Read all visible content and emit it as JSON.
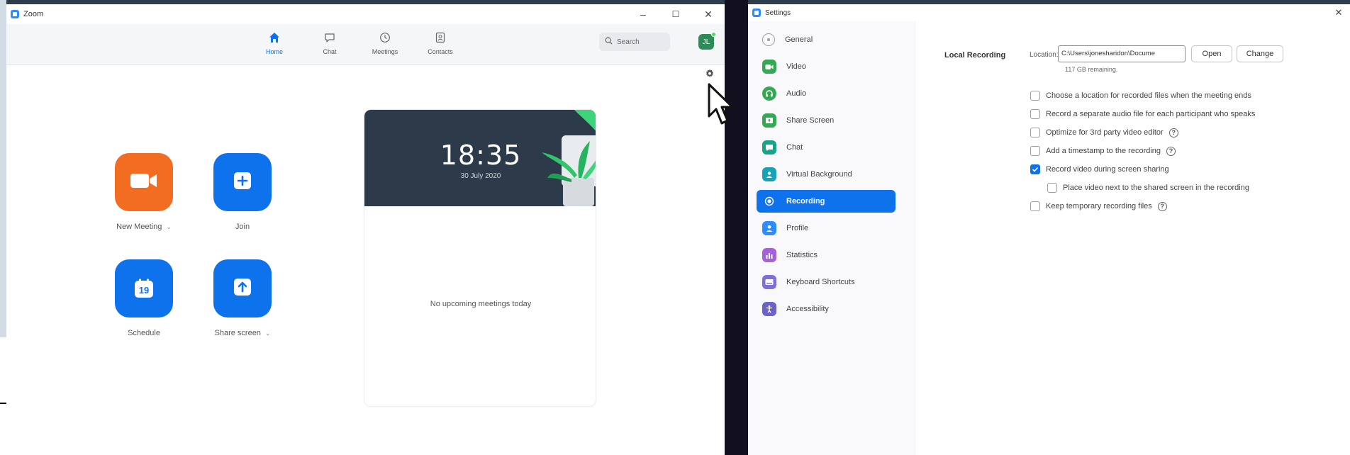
{
  "zoom": {
    "title": "Zoom",
    "window_controls": {
      "minimize": "–",
      "maximize": "☐",
      "close": "✕"
    },
    "nav": [
      {
        "label": "Home",
        "icon": "home-icon",
        "active": true
      },
      {
        "label": "Chat",
        "icon": "chat-icon",
        "active": false
      },
      {
        "label": "Meetings",
        "icon": "clock-icon",
        "active": false
      },
      {
        "label": "Contacts",
        "icon": "contacts-icon",
        "active": false
      }
    ],
    "search_placeholder": "Search",
    "avatar_initial": "JL",
    "actions": [
      {
        "label": "New Meeting",
        "icon": "video-camera-icon",
        "color": "#f26d21",
        "has_dropdown": true
      },
      {
        "label": "Join",
        "icon": "plus-icon",
        "color": "#0e72ed",
        "has_dropdown": false
      },
      {
        "label": "Schedule",
        "icon": "calendar-icon",
        "calendar_day": "19",
        "color": "#0e72ed",
        "has_dropdown": false
      },
      {
        "label": "Share screen",
        "icon": "share-screen-icon",
        "color": "#0e72ed",
        "has_dropdown": true
      }
    ],
    "card": {
      "time": "18:35",
      "date": "30 July 2020",
      "empty_text": "No upcoming meetings today"
    }
  },
  "settings": {
    "title": "Settings",
    "close": "✕",
    "sidebar": [
      {
        "label": "General",
        "icon": "general-icon",
        "color": "#9aa0a6",
        "active": false
      },
      {
        "label": "Video",
        "icon": "video-icon",
        "color": "#34a853",
        "active": false
      },
      {
        "label": "Audio",
        "icon": "audio-icon",
        "color": "#34a853",
        "active": false
      },
      {
        "label": "Share Screen",
        "icon": "share-screen-icon",
        "color": "#34a853",
        "active": false
      },
      {
        "label": "Chat",
        "icon": "chat-icon",
        "color": "#17a589",
        "active": false
      },
      {
        "label": "Virtual Background",
        "icon": "virtual-background-icon",
        "color": "#17a2b8",
        "active": false
      },
      {
        "label": "Recording",
        "icon": "recording-icon",
        "color": "#ffffff",
        "active": true
      },
      {
        "label": "Profile",
        "icon": "profile-icon",
        "color": "#2d8cff",
        "active": false
      },
      {
        "label": "Statistics",
        "icon": "statistics-icon",
        "color": "#a461d8",
        "active": false
      },
      {
        "label": "Keyboard Shortcuts",
        "icon": "keyboard-icon",
        "color": "#7c6fd8",
        "active": false
      },
      {
        "label": "Accessibility",
        "icon": "accessibility-icon",
        "color": "#6c63c9",
        "active": false
      }
    ],
    "local_recording": {
      "section_title": "Local Recording",
      "location_label": "Location:",
      "location_value": "C:\\Users\\jonesharidon\\Docume",
      "open_button": "Open",
      "change_button": "Change",
      "remaining": "117 GB remaining.",
      "options": [
        {
          "label": "Choose a location for recorded files when the meeting ends",
          "checked": false,
          "help": false,
          "indent": false
        },
        {
          "label": "Record a separate audio file for each participant who speaks",
          "checked": false,
          "help": false,
          "indent": false
        },
        {
          "label": "Optimize for 3rd party video editor",
          "checked": false,
          "help": true,
          "indent": false
        },
        {
          "label": "Add a timestamp to the recording",
          "checked": false,
          "help": true,
          "indent": false
        },
        {
          "label": "Record video during screen sharing",
          "checked": true,
          "help": false,
          "indent": false
        },
        {
          "label": "Place video next to the shared screen in the recording",
          "checked": false,
          "help": false,
          "indent": true
        },
        {
          "label": "Keep temporary recording files",
          "checked": false,
          "help": true,
          "indent": false
        }
      ]
    }
  }
}
